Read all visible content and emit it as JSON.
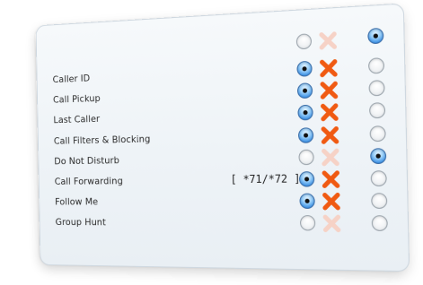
{
  "rows": [
    {
      "label": "Caller ID",
      "code": "",
      "left_selected": true,
      "x_active": true,
      "right_selected": false
    },
    {
      "label": "Call Pickup",
      "code": "",
      "left_selected": true,
      "x_active": true,
      "right_selected": false
    },
    {
      "label": "Last Caller",
      "code": "",
      "left_selected": true,
      "x_active": true,
      "right_selected": false
    },
    {
      "label": "Call Filters & Blocking",
      "code": "",
      "left_selected": true,
      "x_active": true,
      "right_selected": false
    },
    {
      "label": "Do Not Disturb",
      "code": "",
      "left_selected": false,
      "x_active": false,
      "right_selected": true
    },
    {
      "label": "Call Forwarding",
      "code": "[ *71/*72 ]",
      "left_selected": true,
      "x_active": true,
      "right_selected": false
    },
    {
      "label": "Follow Me",
      "code": "",
      "left_selected": true,
      "x_active": true,
      "right_selected": false
    },
    {
      "label": "Group Hunt",
      "code": "",
      "left_selected": false,
      "x_active": false,
      "right_selected": false
    }
  ],
  "header": {
    "left_selected": false,
    "x_active": false,
    "right_selected": true
  },
  "colors": {
    "x_active": "#f05a12",
    "x_inactive": "#f6d2c6",
    "radio_on": "#3b8fe3"
  }
}
